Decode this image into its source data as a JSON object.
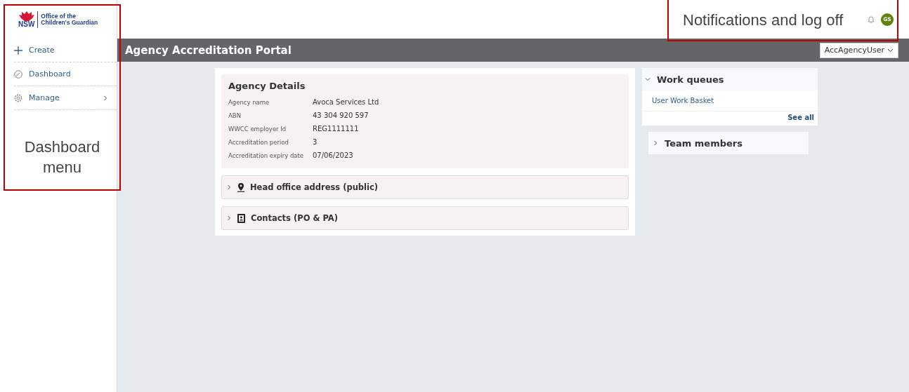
{
  "logo": {
    "mark": "NSW",
    "line_1": "Office of the",
    "line_2": "Children's Guardian"
  },
  "sidebar": {
    "items": [
      {
        "kind": "create",
        "label": "Create",
        "has_submenu": false
      },
      {
        "kind": "dashboard",
        "label": "Dashboard",
        "has_submenu": false
      },
      {
        "kind": "manage",
        "label": "Manage",
        "has_submenu": true
      }
    ]
  },
  "header": {
    "avatar": "GS"
  },
  "title_bar": {
    "title": "Agency Accreditation Portal",
    "user_menu": "AccAgencyUser"
  },
  "agency_details": {
    "title": "Agency Details",
    "fields": [
      {
        "label": "Agency name",
        "value": "Avoca Services Ltd"
      },
      {
        "label": "ABN",
        "value": "43 304 920 597"
      },
      {
        "label": "WWCC employer Id",
        "value": "REG1111111"
      },
      {
        "label": "Accreditation period",
        "value": "3"
      },
      {
        "label": "Accreditation expiry date",
        "value": "07/06/2023"
      }
    ]
  },
  "sections": [
    {
      "kind": "location",
      "title": "Head office address (public)",
      "expanded": false
    },
    {
      "kind": "contact",
      "title": "Contacts (PO & PA)",
      "expanded": false
    }
  ],
  "work_queues": {
    "title": "Work queues",
    "expanded": true,
    "items": [
      "User Work Basket"
    ],
    "link": "See all"
  },
  "team_members": {
    "title": "Team members",
    "expanded": false
  },
  "annotations": [
    {
      "kind": "menu",
      "text": "Dashboard menu"
    },
    {
      "kind": "header",
      "text": "Notifications and log off"
    }
  ]
}
